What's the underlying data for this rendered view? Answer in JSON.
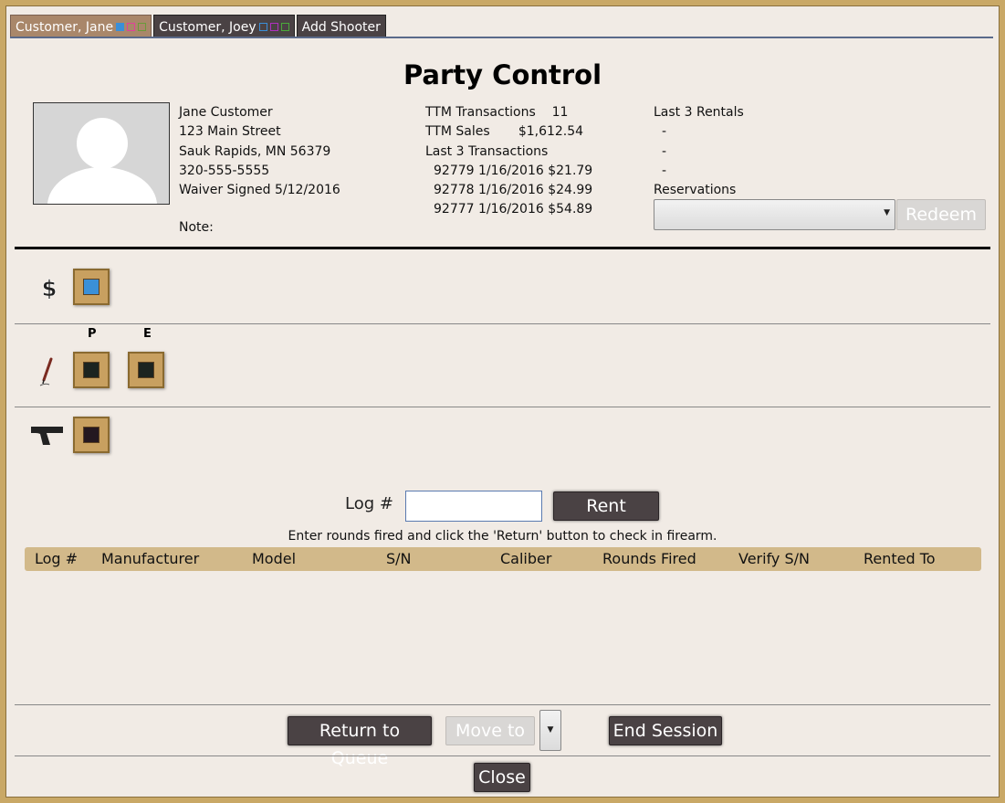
{
  "tabs": [
    {
      "label": "Customer, Jane",
      "active": true
    },
    {
      "label": "Customer, Joey",
      "active": false
    },
    {
      "label": "Add Shooter",
      "active": false
    }
  ],
  "title": "Party Control",
  "customer": {
    "name": "Jane Customer",
    "street": "123 Main Street",
    "city": "Sauk Rapids, MN 56379",
    "phone": "320-555-5555",
    "waiver": "Waiver Signed 5/12/2016",
    "note_label": "Note:"
  },
  "stats": {
    "ttm_transactions_label": "TTM Transactions",
    "ttm_transactions_value": "11",
    "ttm_sales_label": "TTM Sales",
    "ttm_sales_value": "$1,612.54",
    "last3_label": "Last 3 Transactions",
    "transactions": [
      "92779 1/16/2016 $21.79",
      "92778 1/16/2016 $24.99",
      "92777 1/16/2016 $54.89"
    ]
  },
  "rentals": {
    "label": "Last 3 Rentals",
    "items": [
      "-",
      "-",
      "-"
    ],
    "reservations_label": "Reservations",
    "reservations_value": "",
    "redeem_label": "Redeem"
  },
  "sections": {
    "col_p": "P",
    "col_e": "E"
  },
  "log": {
    "label": "Log #",
    "value": "",
    "rent_label": "Rent",
    "hint": "Enter rounds fired and click the 'Return' button to check in firearm."
  },
  "table": {
    "headers": [
      "Log #",
      "Manufacturer",
      "Model",
      "S/N",
      "Caliber",
      "Rounds Fired",
      "Verify S/N",
      "Rented To"
    ]
  },
  "footer": {
    "return_label": "Return to Queue",
    "move_label": "Move to",
    "end_label": "End Session",
    "close_label": "Close"
  },
  "colors": {
    "frame": "#c9a866",
    "background": "#f1ebe5",
    "dark_button": "#4a4244",
    "table_header": "#d2b98a",
    "accent_blue": "#3a8fd8"
  }
}
